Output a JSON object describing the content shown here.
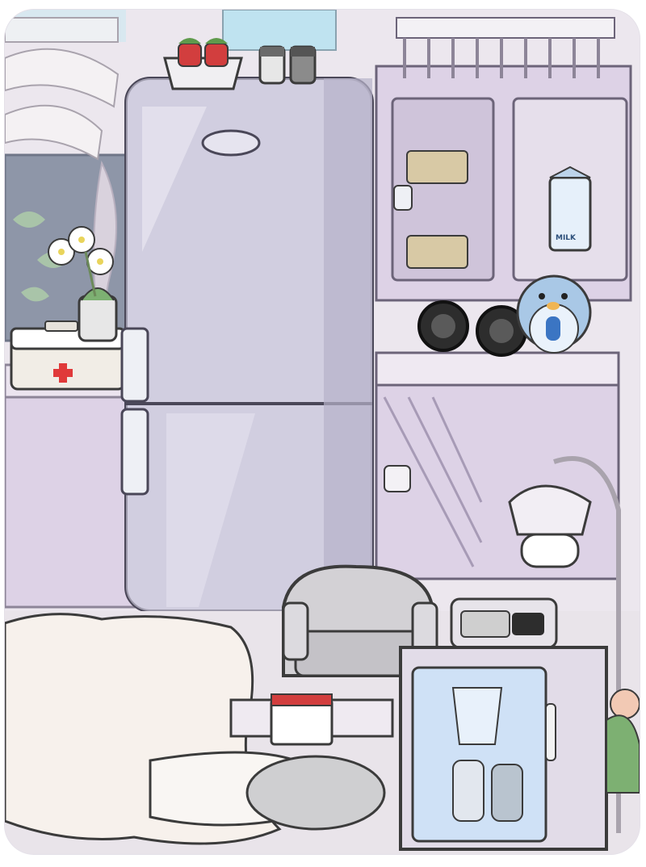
{
  "scene": {
    "room": "kitchen",
    "colors": {
      "wall": "#ece7ee",
      "floor": "#e9e4ea",
      "cabinet": "#ddd2e6",
      "fridge": "#c9c6da",
      "rug": "#f7f1ec",
      "medical_cross": "#e03a3a",
      "mini_fridge_glass": "#cfe1f6"
    }
  },
  "objects": {
    "milk_carton": {
      "label": "MILK"
    }
  }
}
